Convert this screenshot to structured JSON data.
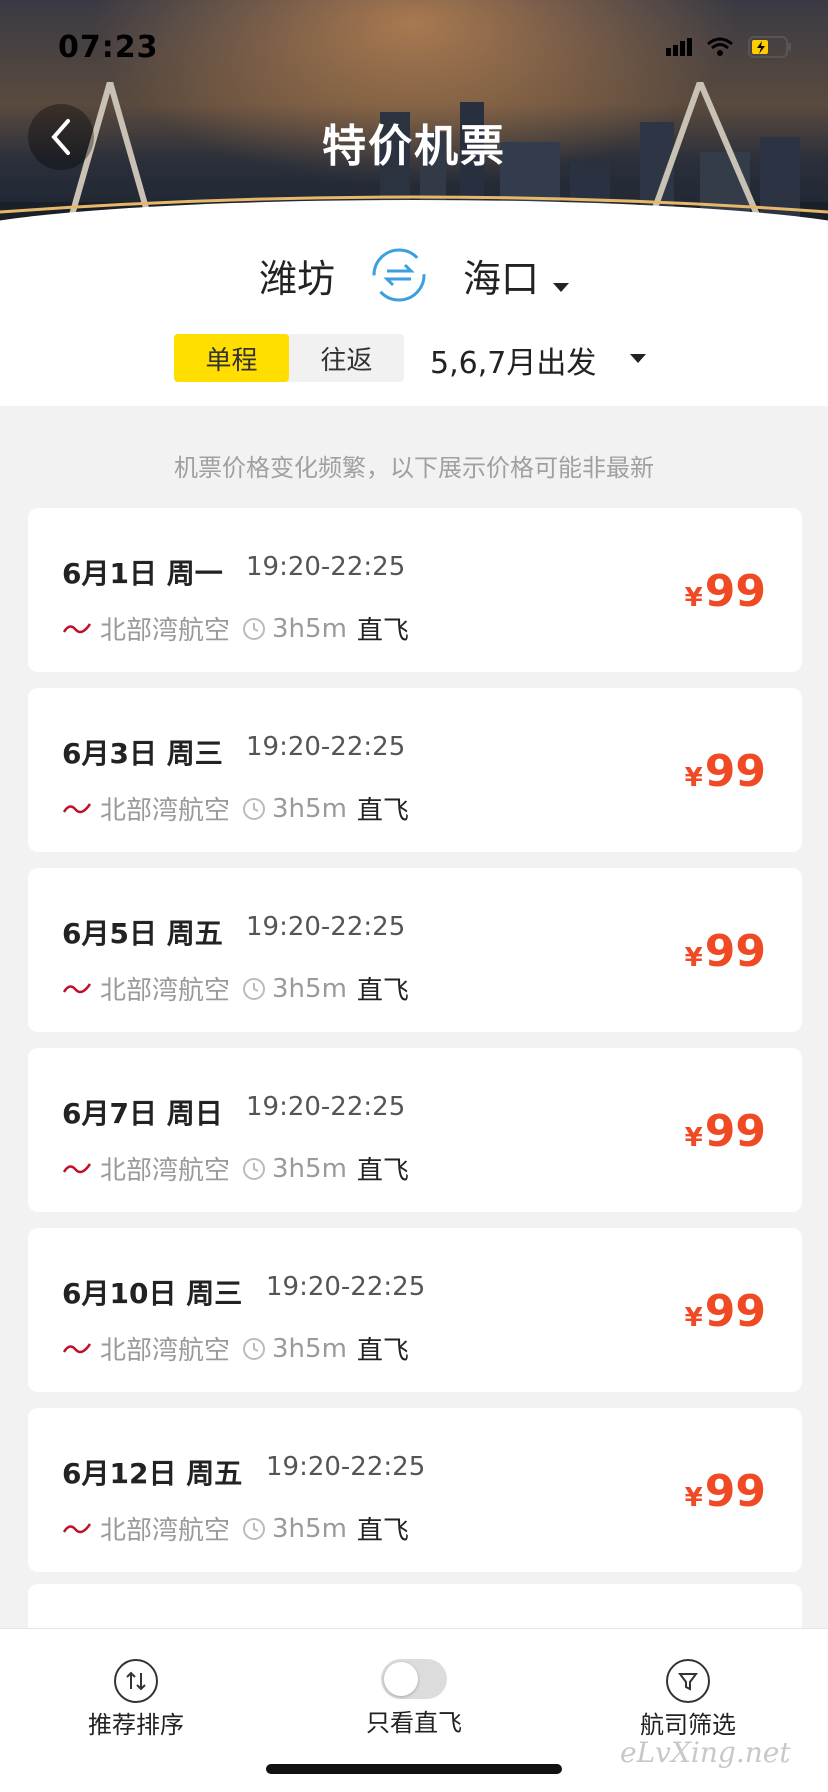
{
  "status_bar": {
    "time": "07:23"
  },
  "header": {
    "title": "特价机票"
  },
  "route": {
    "from": "潍坊",
    "to": "海口"
  },
  "trip": {
    "tabs": [
      {
        "label": "单程",
        "active": true
      },
      {
        "label": "往返",
        "active": false
      }
    ],
    "date_filter": "5,6,7月出发"
  },
  "notice": "机票价格变化频繁，以下展示价格可能非最新",
  "flights": [
    {
      "date": "6月1日 周一",
      "time": "19:20-22:25",
      "airline": "北部湾航空",
      "duration": "3h5m",
      "type": "直飞",
      "currency": "¥",
      "price": "99"
    },
    {
      "date": "6月3日 周三",
      "time": "19:20-22:25",
      "airline": "北部湾航空",
      "duration": "3h5m",
      "type": "直飞",
      "currency": "¥",
      "price": "99"
    },
    {
      "date": "6月5日 周五",
      "time": "19:20-22:25",
      "airline": "北部湾航空",
      "duration": "3h5m",
      "type": "直飞",
      "currency": "¥",
      "price": "99"
    },
    {
      "date": "6月7日 周日",
      "time": "19:20-22:25",
      "airline": "北部湾航空",
      "duration": "3h5m",
      "type": "直飞",
      "currency": "¥",
      "price": "99"
    },
    {
      "date": "6月10日 周三",
      "time": "19:20-22:25",
      "airline": "北部湾航空",
      "duration": "3h5m",
      "type": "直飞",
      "currency": "¥",
      "price": "99"
    },
    {
      "date": "6月12日 周五",
      "time": "19:20-22:25",
      "airline": "北部湾航空",
      "duration": "3h5m",
      "type": "直飞",
      "currency": "¥",
      "price": "99"
    }
  ],
  "bottom_bar": {
    "sort_label": "推荐排序",
    "direct_label": "只看直飞",
    "direct_only": false,
    "filter_label": "航司筛选"
  },
  "watermark": "eLvXing.net",
  "colors": {
    "accent_yellow": "#ffde00",
    "price_red": "#ef4a24",
    "swap_blue": "#3aa0e0"
  }
}
